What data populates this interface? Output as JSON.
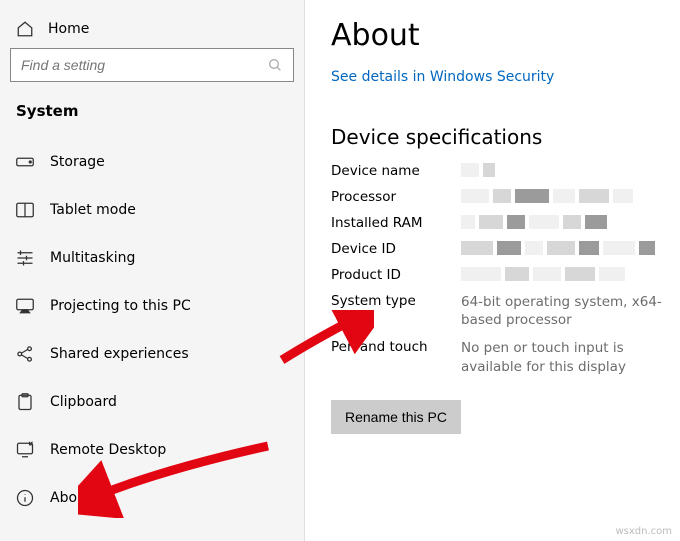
{
  "home": {
    "label": "Home"
  },
  "search": {
    "placeholder": "Find a setting"
  },
  "section": "System",
  "nav": {
    "storage": "Storage",
    "tablet": "Tablet mode",
    "multitask": "Multitasking",
    "projecting": "Projecting to this PC",
    "shared": "Shared experiences",
    "clipboard": "Clipboard",
    "remote": "Remote Desktop",
    "about": "About"
  },
  "page": {
    "title": "About",
    "link": "See details in Windows Security",
    "subheader": "Device specifications",
    "specs": {
      "device_name": "Device name",
      "processor": "Processor",
      "ram": "Installed RAM",
      "device_id": "Device ID",
      "product_id": "Product ID",
      "system_type_label": "System type",
      "system_type_value": "64-bit operating system, x64-based processor",
      "pen_label": "Pen and touch",
      "pen_value": "No pen or touch input is available for this display"
    },
    "rename_btn": "Rename this PC"
  },
  "watermark": "wsxdn.com"
}
